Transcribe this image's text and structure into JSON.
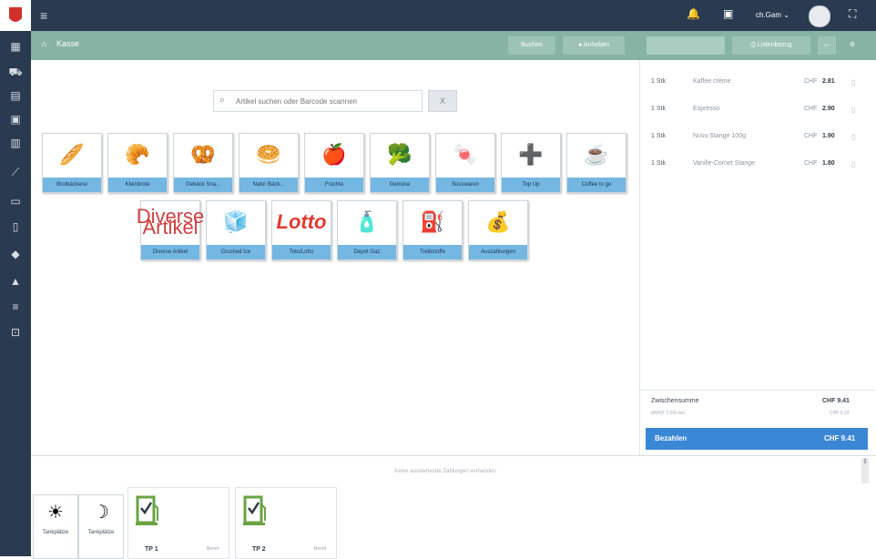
{
  "topbar": {
    "user_label": "ch.Gam ⌄"
  },
  "toolbar": {
    "breadcrumb": "Kasse",
    "buttons": [
      "Buchen",
      "Anheben",
      "",
      "Listenbezug"
    ]
  },
  "search": {
    "placeholder": "Artikel suchen oder Barcode scannen",
    "clear_label": "X"
  },
  "tiles_row1": [
    {
      "label": "Brotbäckerei",
      "icon": "🥖"
    },
    {
      "label": "Kleinbrote",
      "icon": "🥐"
    },
    {
      "label": "Gebäck Sna...",
      "icon": "🥨"
    },
    {
      "label": "Natur Bäck...",
      "icon": "🥯"
    },
    {
      "label": "Früchte",
      "icon": "🍎"
    },
    {
      "label": "Gemüse",
      "icon": "🥦"
    },
    {
      "label": "Süsswaren",
      "icon": "🍬"
    },
    {
      "label": "Top Up",
      "icon": "➕"
    },
    {
      "label": "Coffee to go",
      "icon": "☕"
    }
  ],
  "tiles_row2": [
    {
      "label": "Diverse Artikel",
      "icon": "Diverse Artikel"
    },
    {
      "label": "Crushed Ice",
      "icon": "🧊"
    },
    {
      "label": "Toto/Lotto",
      "icon": "Lotto"
    },
    {
      "label": "Depot Gaz",
      "icon": "🧴"
    },
    {
      "label": "Treibstoffe",
      "icon": "⛽"
    },
    {
      "label": "Auszahlungen",
      "icon": "💰"
    }
  ],
  "cart": {
    "items": [
      {
        "qty": "1 Stk",
        "name": "Kaffee crème",
        "currency": "CHF",
        "price": "2.81"
      },
      {
        "qty": "1 Stk",
        "name": "Espresso",
        "currency": "CHF",
        "price": "2.90"
      },
      {
        "qty": "1 Stk",
        "name": "Nuss-Stange 100g",
        "currency": "CHF",
        "price": "1.90"
      },
      {
        "qty": "1 Stk",
        "name": "Vanille-Cornet Stange",
        "currency": "CHF",
        "price": "1.80"
      }
    ],
    "subtotal_label": "Zwischensumme",
    "subtotal_value": "CHF 9.41",
    "vat_label": "MWST 2.5% inkl.",
    "vat_value": "CHF 0.23",
    "pay_label": "Bezahlen",
    "pay_value": "CHF 9.41"
  },
  "lower": {
    "notice": "Keine ausstehende Zahlungen vorhanden",
    "modes": [
      {
        "label": "Tankplätze",
        "icon": "☀"
      },
      {
        "label": "Tankplätze",
        "icon": "☽"
      }
    ],
    "pumps": [
      {
        "label": "TP 1",
        "status": "Bereit"
      },
      {
        "label": "TP 2",
        "status": "Bereit"
      }
    ]
  },
  "colors": {
    "sidebar": "#2a3a50",
    "toolbar": "#86b3a4",
    "tile_label": "#74b7e2",
    "pay": "#3a87d6",
    "pump_green": "#6aa342"
  }
}
